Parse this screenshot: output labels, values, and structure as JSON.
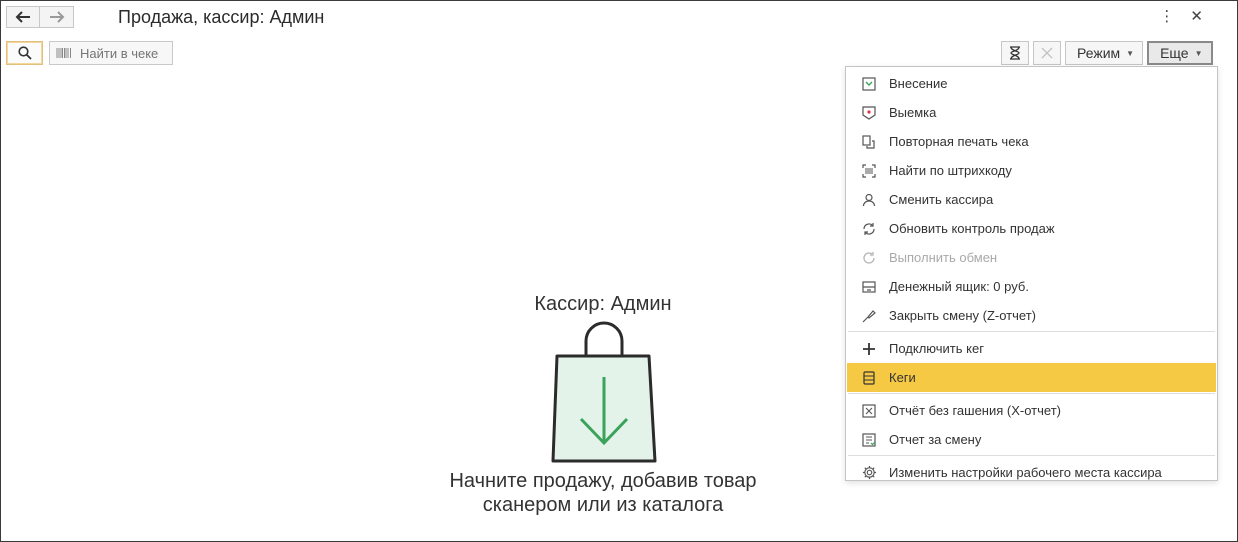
{
  "window": {
    "title": "Продажа, кассир: Админ"
  },
  "toolbar": {
    "search_placeholder": "Найти в чеке",
    "mode_label": "Режим",
    "more_label": "Еще"
  },
  "main": {
    "cashier_label": "Кассир: Админ",
    "hint_line1": "Начните продажу, добавив товар",
    "hint_line2": "сканером или из каталога"
  },
  "menu": {
    "items": [
      {
        "label": "Внесение",
        "icon": "deposit-icon"
      },
      {
        "label": "Выемка",
        "icon": "withdrawal-icon"
      },
      {
        "label": "Повторная печать чека",
        "icon": "reprint-icon"
      },
      {
        "label": "Найти по штрихкоду",
        "icon": "barcode-scan-icon"
      },
      {
        "label": "Сменить кассира",
        "icon": "user-icon"
      },
      {
        "label": "Обновить контроль продаж",
        "icon": "refresh-control-icon"
      },
      {
        "label": "Выполнить обмен",
        "icon": "sync-icon",
        "disabled": true
      },
      {
        "label": "Денежный ящик: 0 руб.",
        "icon": "cash-drawer-icon"
      },
      {
        "label": "Закрыть смену (Z-отчет)",
        "icon": "close-shift-icon"
      },
      {
        "label": "Подключить кег",
        "icon": "plus-icon"
      },
      {
        "label": "Кеги",
        "icon": "keg-icon",
        "selected": true
      },
      {
        "label": "Отчёт без гашения (X-отчет)",
        "icon": "x-report-icon"
      },
      {
        "label": "Отчет за смену",
        "icon": "shift-report-icon"
      },
      {
        "label": "Изменить настройки рабочего места кассира",
        "icon": "gear-icon"
      }
    ]
  },
  "colors": {
    "accent": "#f6c944",
    "bag_fill": "#e3f3ea",
    "arrow": "#3aa25a"
  }
}
